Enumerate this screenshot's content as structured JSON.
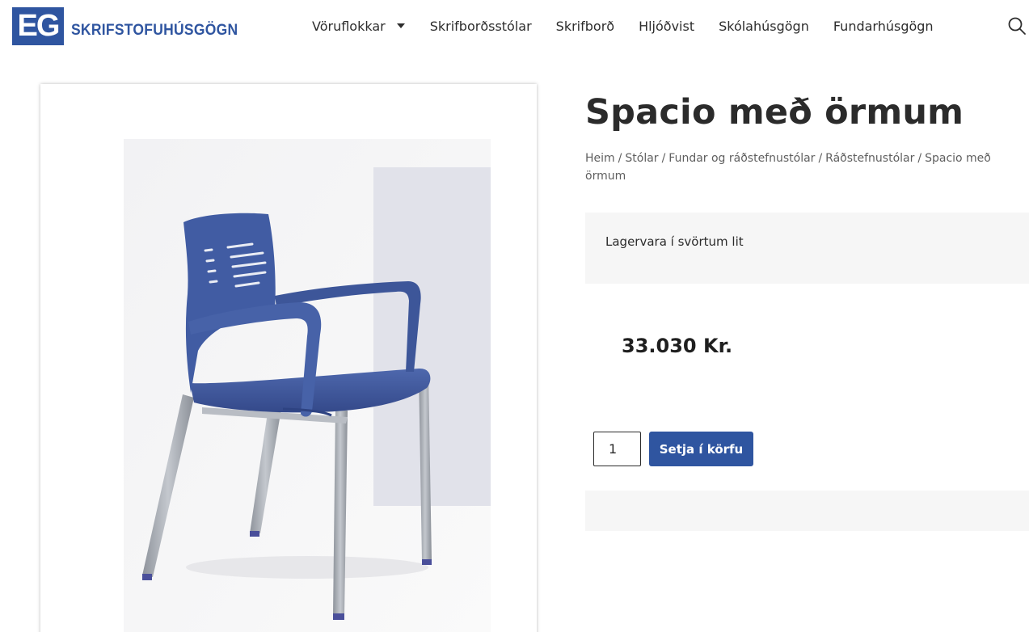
{
  "brand": {
    "logo_mark": "EG",
    "logo_text": "SKRIFSTOFUHÚSGÖGN",
    "color": "#2f55a0"
  },
  "nav": {
    "items": [
      {
        "label": "Vöruflokkar",
        "has_dropdown": true
      },
      {
        "label": "Skrifborðsstólar"
      },
      {
        "label": "Skrifborð"
      },
      {
        "label": "Hljóðvist"
      },
      {
        "label": "Skólahúsgögn"
      },
      {
        "label": "Fundarhúsgögn"
      }
    ],
    "search_icon": "search-icon"
  },
  "product": {
    "title": "Spacio með örmum",
    "breadcrumb": [
      "Heim",
      "Stólar",
      "Fundar og ráðstefnustólar",
      "Ráðstefnustólar",
      "Spacio með örmum"
    ],
    "note": "Lagervara í svörtum lit",
    "price": "33.030 Kr.",
    "quantity": "1",
    "add_to_cart_label": "Setja í körfu"
  },
  "colors": {
    "accent": "#2f55a0",
    "panel_bg": "#f6f6f6",
    "chair_blue": "#3f5a9c"
  }
}
